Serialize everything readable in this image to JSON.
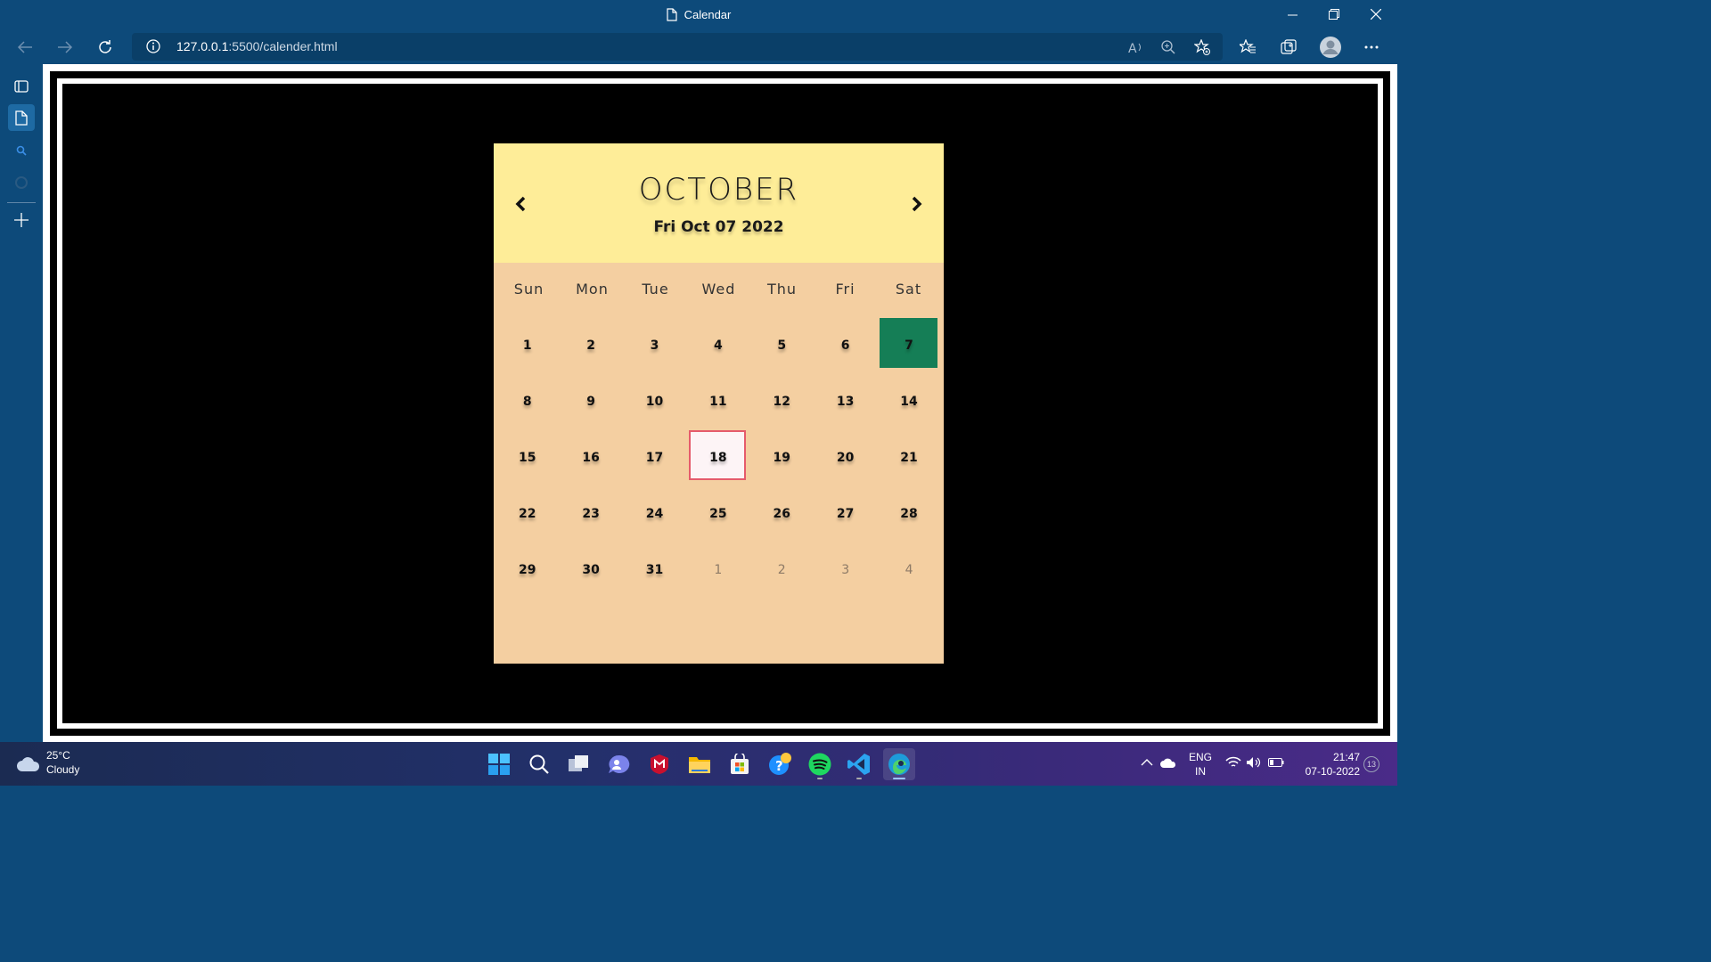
{
  "window": {
    "title": "Calendar"
  },
  "toolbar": {
    "url_host": "127.0.0.1",
    "url_path": ":5500/calender.html"
  },
  "calendar": {
    "month": "OCTOBER",
    "full_date": "Fri Oct 07 2022",
    "weekdays": [
      "Sun",
      "Mon",
      "Tue",
      "Wed",
      "Thu",
      "Fri",
      "Sat"
    ],
    "today": "7",
    "selected": "18",
    "days": [
      {
        "n": "1",
        "state": ""
      },
      {
        "n": "2",
        "state": ""
      },
      {
        "n": "3",
        "state": ""
      },
      {
        "n": "4",
        "state": ""
      },
      {
        "n": "5",
        "state": ""
      },
      {
        "n": "6",
        "state": ""
      },
      {
        "n": "7",
        "state": "today"
      },
      {
        "n": "8",
        "state": ""
      },
      {
        "n": "9",
        "state": ""
      },
      {
        "n": "10",
        "state": ""
      },
      {
        "n": "11",
        "state": ""
      },
      {
        "n": "12",
        "state": ""
      },
      {
        "n": "13",
        "state": ""
      },
      {
        "n": "14",
        "state": ""
      },
      {
        "n": "15",
        "state": ""
      },
      {
        "n": "16",
        "state": ""
      },
      {
        "n": "17",
        "state": ""
      },
      {
        "n": "18",
        "state": "selected"
      },
      {
        "n": "19",
        "state": ""
      },
      {
        "n": "20",
        "state": ""
      },
      {
        "n": "21",
        "state": ""
      },
      {
        "n": "22",
        "state": ""
      },
      {
        "n": "23",
        "state": ""
      },
      {
        "n": "24",
        "state": ""
      },
      {
        "n": "25",
        "state": ""
      },
      {
        "n": "26",
        "state": ""
      },
      {
        "n": "27",
        "state": ""
      },
      {
        "n": "28",
        "state": ""
      },
      {
        "n": "29",
        "state": ""
      },
      {
        "n": "30",
        "state": ""
      },
      {
        "n": "31",
        "state": ""
      },
      {
        "n": "1",
        "state": "muted"
      },
      {
        "n": "2",
        "state": "muted"
      },
      {
        "n": "3",
        "state": "muted"
      },
      {
        "n": "4",
        "state": "muted"
      }
    ],
    "colors": {
      "header_bg": "#feed98",
      "body_bg": "#f4cfa1",
      "today_bg": "#157e56",
      "selected_border": "#e55b6b"
    }
  },
  "taskbar": {
    "weather_temp": "25°C",
    "weather_condition": "Cloudy",
    "lang_line1": "ENG",
    "lang_line2": "IN",
    "time": "21:47",
    "date": "07-10-2022",
    "notification_count": "13",
    "apps": [
      "start-icon",
      "search-icon",
      "task-view-icon",
      "teams-chat-icon",
      "mcafee-icon",
      "file-explorer-icon",
      "microsoft-store-icon",
      "get-help-icon",
      "spotify-icon",
      "vscode-icon",
      "edge-icon"
    ]
  }
}
